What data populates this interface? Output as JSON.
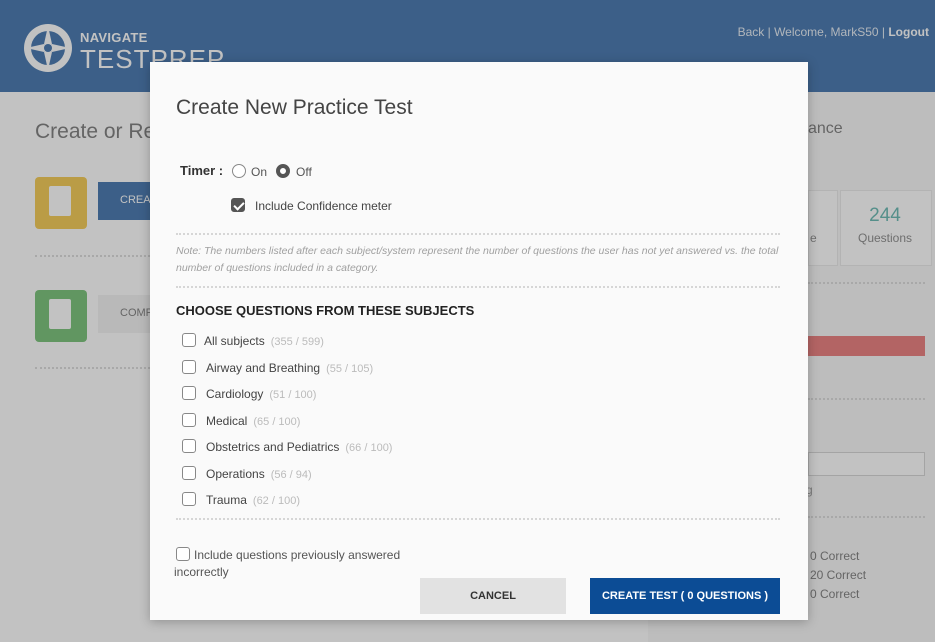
{
  "header": {
    "brand_top": "NAVIGATE",
    "brand_bottom": "TESTPREP",
    "back_link": "Back",
    "welcome": "Welcome, MarkS50",
    "logout": "Logout",
    "bar_color": "#0c4c95"
  },
  "background": {
    "title": "Create or Re",
    "create_button": "CREA",
    "comp_button": "COMP",
    "performance_title": "ance",
    "stat_number": "244",
    "stat_label": "Questions",
    "stat_partial": "e",
    "partial_letter": "g",
    "correct_lines": [
      "0 Correct",
      "20 Correct",
      "0 Correct"
    ]
  },
  "modal": {
    "title": "Create New Practice Test",
    "timer_label": "Timer :",
    "timer_options": [
      {
        "label": "On",
        "selected": false
      },
      {
        "label": "Off",
        "selected": true
      }
    ],
    "confidence_meter": {
      "label": "Include Confidence meter",
      "checked": true
    },
    "note": "Note: The numbers listed after each subject/system represent the number of questions the user has not yet answered vs. the total number of questions included in a category.",
    "subjects_header": "CHOOSE QUESTIONS FROM THESE SUBJECTS",
    "subjects": [
      {
        "name": "All subjects",
        "count": "(355 / 599)",
        "checked": false
      },
      {
        "name": "Airway and Breathing",
        "count": "(55 / 105)",
        "checked": false
      },
      {
        "name": "Cardiology",
        "count": "(51 / 100)",
        "checked": false
      },
      {
        "name": "Medical",
        "count": "(65 / 100)",
        "checked": false
      },
      {
        "name": "Obstetrics and Pediatrics",
        "count": "(66 / 100)",
        "checked": false
      },
      {
        "name": "Operations",
        "count": "(56 / 94)",
        "checked": false
      },
      {
        "name": "Trauma",
        "count": "(62 / 100)",
        "checked": false
      }
    ],
    "previously_incorrect": {
      "label": "Include questions previously answered incorrectly",
      "checked": false
    },
    "cancel_button": "CANCEL",
    "create_button": "CREATE TEST ( 0 QUESTIONS )",
    "accent_color": "#0c4c95"
  }
}
